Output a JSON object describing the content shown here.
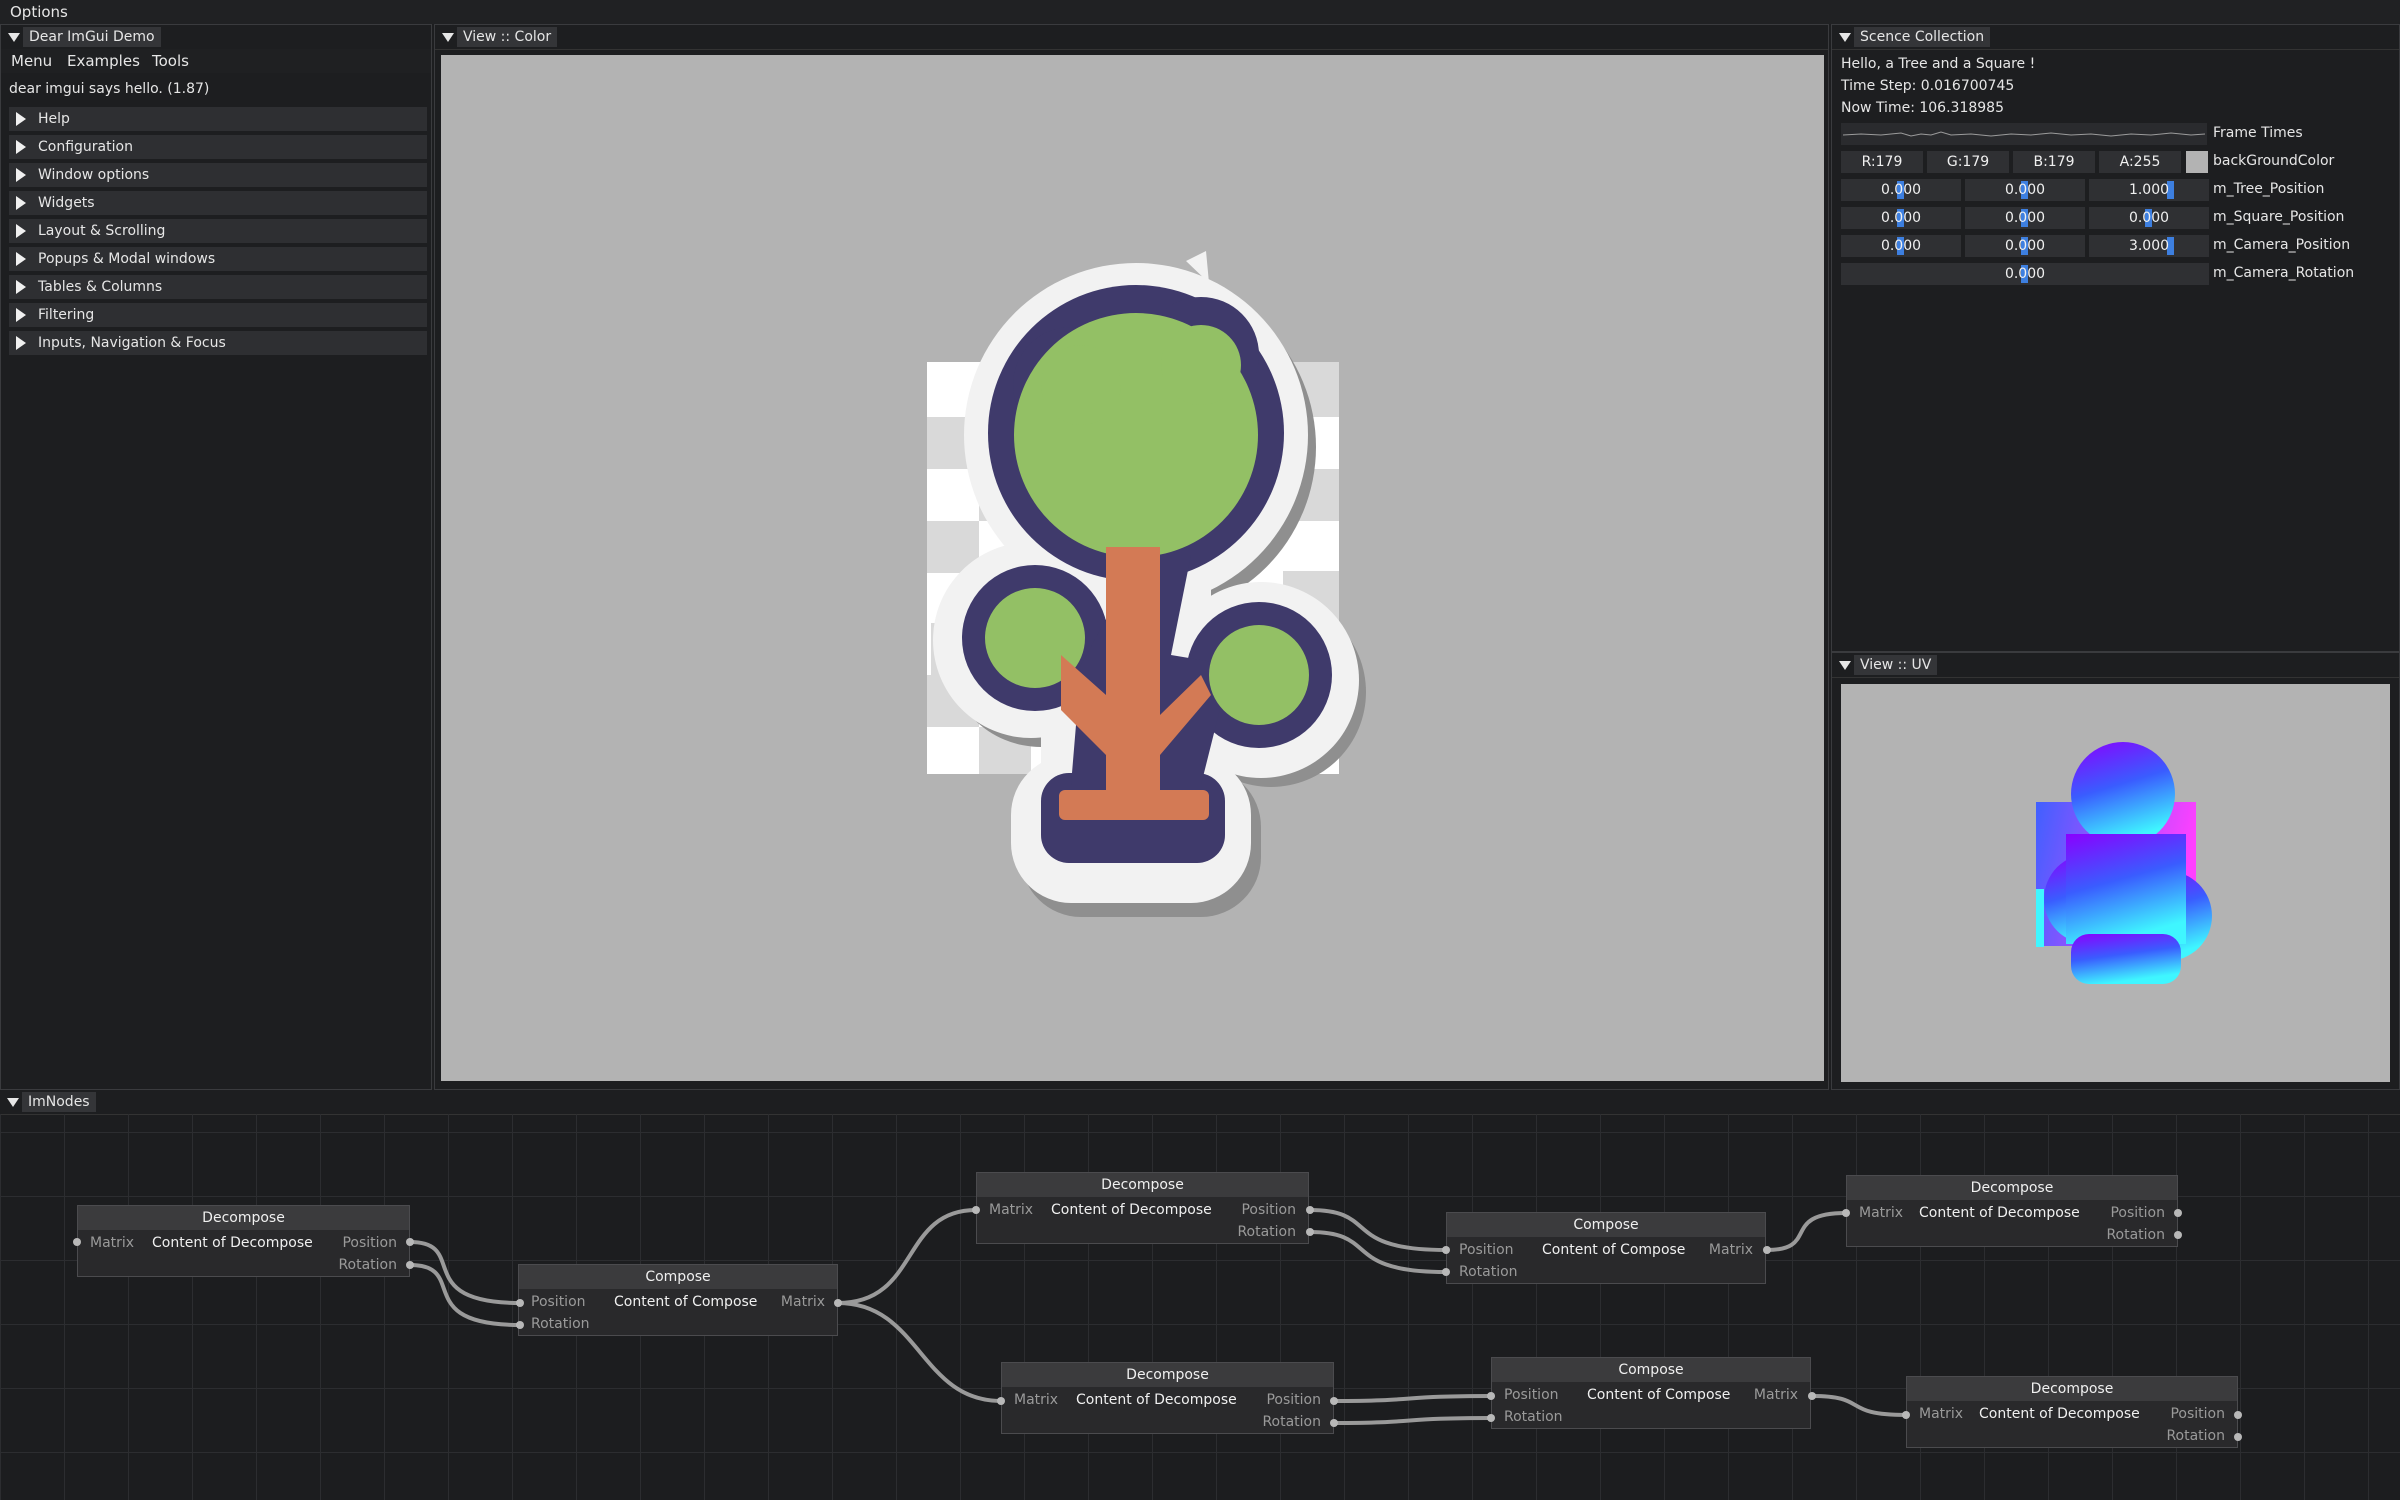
{
  "top_menu": "Options",
  "demo": {
    "title": "Dear ImGui Demo",
    "menubar": [
      "Menu",
      "Examples",
      "Tools"
    ],
    "hello": "dear imgui says hello. (1.87)",
    "headers": [
      "Help",
      "Configuration",
      "Window options",
      "Widgets",
      "Layout & Scrolling",
      "Popups & Modal windows",
      "Tables & Columns",
      "Filtering",
      "Inputs, Navigation & Focus"
    ]
  },
  "color_view": {
    "title": "View :: Color"
  },
  "scene": {
    "title": "Scence Collection",
    "line1": "Hello, a Tree and a Square !",
    "time_step": "Time Step: 0.016700745",
    "now_time": "Now Time: 106.318985",
    "frame_times": "Frame Times",
    "bg": {
      "r": "R:179",
      "g": "G:179",
      "b": "B:179",
      "a": "A:255",
      "label": "backGroundColor",
      "swatch": "#b3b3b3"
    },
    "tree_pos": {
      "x": "0.000",
      "y": "0.000",
      "z": "1.000",
      "label": "m_Tree_Position"
    },
    "square_pos": {
      "x": "0.000",
      "y": "0.000",
      "z": "0.000",
      "label": "m_Square_Position"
    },
    "camera_pos": {
      "x": "0.000",
      "y": "0.000",
      "z": "3.000",
      "label": "m_Camera_Position"
    },
    "camera_rot": {
      "v": "0.000",
      "label": "m_Camera_Rotation"
    }
  },
  "uv_view": {
    "title": "View :: UV"
  },
  "nodes": {
    "title": "ImNodes",
    "decompose": {
      "title": "Decompose",
      "in": "Matrix",
      "content": "Content of Decompose",
      "out1": "Position",
      "out2": "Rotation"
    },
    "compose": {
      "title": "Compose",
      "in1": "Position",
      "in2": "Rotation",
      "content": "Content of Compose",
      "out": "Matrix"
    }
  },
  "colors": {
    "accent": "#3d7fe0",
    "tree_leaf": "#93c065",
    "tree_trunk": "#d37a55",
    "outline": "#3f3a6b"
  }
}
